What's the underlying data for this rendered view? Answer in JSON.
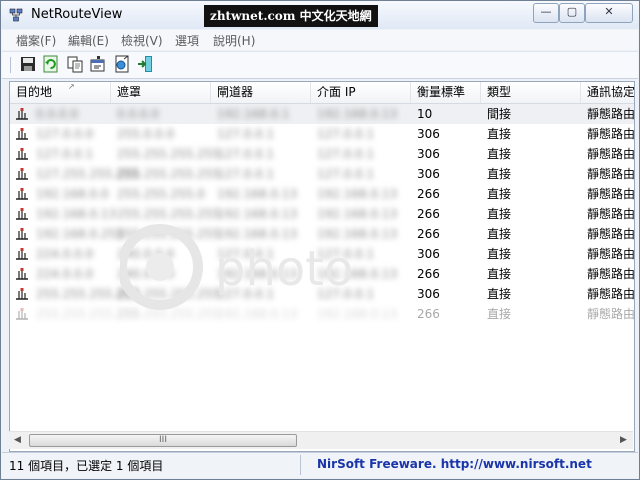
{
  "window": {
    "title": "NetRouteView",
    "watermark": "zhtwnet.com 中文化天地網",
    "controls": {
      "minimize": "—",
      "maximize": "▢",
      "close": "✕"
    }
  },
  "menu": [
    "檔案(F)",
    "編輯(E)",
    "檢視(V)",
    "選項",
    "說明(H)"
  ],
  "toolbar": {
    "buttons": [
      "save-icon",
      "refresh-icon",
      "copy-icon",
      "properties-icon",
      "html-report-icon",
      "exit-icon"
    ]
  },
  "table": {
    "columns": [
      "目的地",
      "遮罩",
      "閘道器",
      "介面 IP",
      "衡量標準",
      "類型",
      "通訊協定"
    ],
    "rows": [
      {
        "dest": "0.0.0.0",
        "mask": "0.0.0.0",
        "gw": "192.168.0.1",
        "iface": "192.168.0.13",
        "metric": "10",
        "type": "間接",
        "proto": "靜態路由"
      },
      {
        "dest": "127.0.0.0",
        "mask": "255.0.0.0",
        "gw": "127.0.0.1",
        "iface": "127.0.0.1",
        "metric": "306",
        "type": "直接",
        "proto": "靜態路由"
      },
      {
        "dest": "127.0.0.1",
        "mask": "255.255.255.255",
        "gw": "127.0.0.1",
        "iface": "127.0.0.1",
        "metric": "306",
        "type": "直接",
        "proto": "靜態路由"
      },
      {
        "dest": "127.255.255.255",
        "mask": "255.255.255.255",
        "gw": "127.0.0.1",
        "iface": "127.0.0.1",
        "metric": "306",
        "type": "直接",
        "proto": "靜態路由"
      },
      {
        "dest": "192.168.0.0",
        "mask": "255.255.255.0",
        "gw": "192.168.0.13",
        "iface": "192.168.0.13",
        "metric": "266",
        "type": "直接",
        "proto": "靜態路由"
      },
      {
        "dest": "192.168.0.13",
        "mask": "255.255.255.255",
        "gw": "192.168.0.13",
        "iface": "192.168.0.13",
        "metric": "266",
        "type": "直接",
        "proto": "靜態路由"
      },
      {
        "dest": "192.168.0.255",
        "mask": "255.255.255.255",
        "gw": "192.168.0.13",
        "iface": "192.168.0.13",
        "metric": "266",
        "type": "直接",
        "proto": "靜態路由"
      },
      {
        "dest": "224.0.0.0",
        "mask": "240.0.0.0",
        "gw": "127.0.0.1",
        "iface": "127.0.0.1",
        "metric": "306",
        "type": "直接",
        "proto": "靜態路由"
      },
      {
        "dest": "224.0.0.0",
        "mask": "240.0.0.0",
        "gw": "192.168.0.13",
        "iface": "192.168.0.13",
        "metric": "266",
        "type": "直接",
        "proto": "靜態路由"
      },
      {
        "dest": "255.255.255.255",
        "mask": "255.255.255.255",
        "gw": "127.0.0.1",
        "iface": "127.0.0.1",
        "metric": "306",
        "type": "直接",
        "proto": "靜態路由"
      },
      {
        "dest": "255.255.255.255",
        "mask": "255.255.255.255",
        "gw": "192.168.0.13",
        "iface": "192.168.0.13",
        "metric": "266",
        "type": "直接",
        "proto": "靜態路由"
      }
    ]
  },
  "scrollbar": {
    "left_arrow": "◀",
    "right_arrow": "▶",
    "grip": "III"
  },
  "status": {
    "items": "11 個項目，已選定 1 個項目",
    "link": "NirSoft Freeware.  http://www.nirsoft.net"
  },
  "colors": {
    "link": "#1a35a8",
    "selection": "#eef0f3"
  }
}
